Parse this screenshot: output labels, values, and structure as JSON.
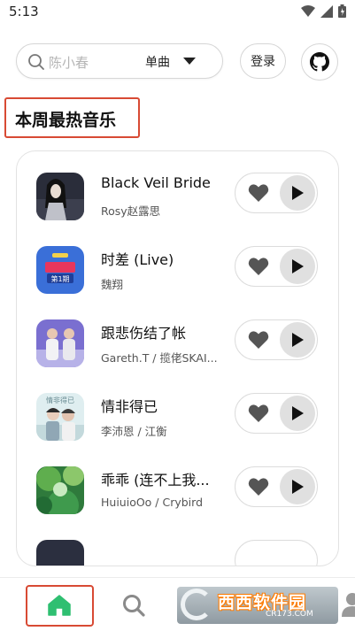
{
  "status_bar": {
    "time": "5:13"
  },
  "search": {
    "placeholder": "陈小春",
    "type_label": "单曲"
  },
  "header": {
    "login_label": "登录"
  },
  "section": {
    "title": "本周最热音乐"
  },
  "songs": [
    {
      "title": "Black Veil Bride",
      "artist": "Rosy赵露思"
    },
    {
      "title": "时差 (Live)",
      "artist": "魏翔"
    },
    {
      "title": "跟悲伤结了帐",
      "artist": "Gareth.T / 揽佬SKAI..."
    },
    {
      "title": "情非得已",
      "artist": "李沛恩 / 江衡"
    },
    {
      "title": "乖乖 (连不上我...",
      "artist": "HuiuioOo / Crybird"
    }
  ],
  "watermark": {
    "text": "西西软件园",
    "sub": "CR173.COM"
  },
  "colors": {
    "accent_green": "#2fbf71",
    "highlight_red": "#d84a34"
  }
}
